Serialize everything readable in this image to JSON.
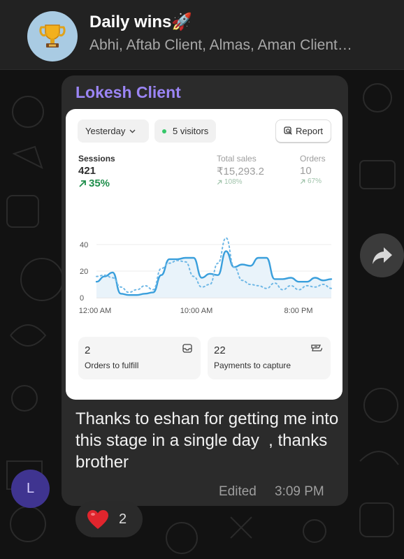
{
  "header": {
    "title": "Daily wins🚀",
    "members": "Abhi, Aftab Client, Almas, Aman Client…",
    "avatar_icon": "trophy-icon"
  },
  "message": {
    "sender": "Lokesh Client",
    "sender_color": "#9b85f5",
    "avatar_initial": "L",
    "text": "Thanks to eshan for getting me into this stage in a single day  , thanks brother",
    "edited_label": "Edited",
    "time": "3:09 PM"
  },
  "card": {
    "date_range": "Yesterday",
    "visitors": "5 visitors",
    "report_label": "Report",
    "metrics": {
      "sessions": {
        "label": "Sessions",
        "value": "421",
        "change": "35%"
      },
      "sales": {
        "label": "Total sales",
        "value": "₹15,293.2",
        "change": "108%"
      },
      "orders": {
        "label": "Orders",
        "value": "10",
        "change": "67%"
      }
    },
    "tiles": {
      "fulfill": {
        "value": "2",
        "label": "Orders to fulfill",
        "icon": "inbox-icon"
      },
      "payments": {
        "value": "22",
        "label": "Payments to capture",
        "icon": "cash-icon"
      }
    }
  },
  "chart_data": {
    "type": "line",
    "yticks": [
      "40",
      "20",
      "0"
    ],
    "xticks": [
      "12:00 AM",
      "10:00 AM",
      "8:00 PM"
    ],
    "ylim": [
      0,
      50
    ],
    "series": [
      {
        "color": "#3a9fdc",
        "style": "solid",
        "values": [
          12,
          16,
          19,
          3,
          2,
          2,
          3,
          4,
          17,
          29,
          29,
          30,
          30,
          15,
          18,
          17,
          35,
          23,
          25,
          24,
          30,
          30,
          14,
          14,
          15,
          12,
          12,
          15,
          13,
          14
        ]
      },
      {
        "color": "#6fb8e6",
        "style": "dotted",
        "values": [
          16,
          17,
          15,
          8,
          4,
          6,
          9,
          6,
          22,
          26,
          28,
          27,
          16,
          8,
          10,
          26,
          45,
          23,
          13,
          10,
          9,
          7,
          11,
          6,
          9,
          6,
          9,
          8,
          10,
          7
        ]
      }
    ]
  },
  "reaction": {
    "emoji": "❤️",
    "count": "2"
  },
  "colors": {
    "background": "#121212",
    "bubble": "#2b2b2b",
    "accent_green": "#1f8e4b"
  }
}
